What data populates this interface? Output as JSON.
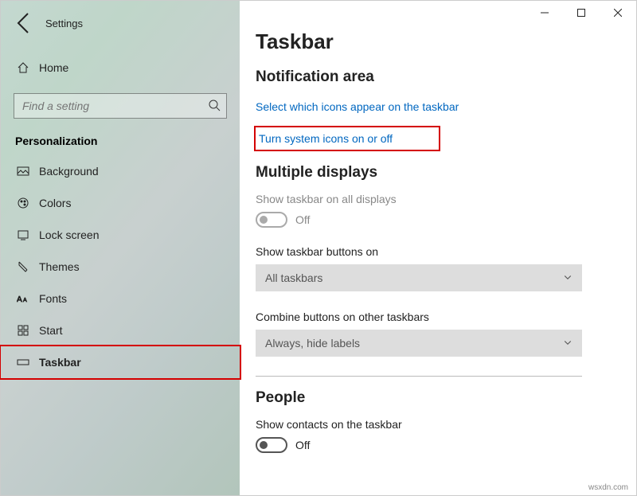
{
  "window": {
    "app_title": "Settings"
  },
  "sidebar": {
    "home_label": "Home",
    "search_placeholder": "Find a setting",
    "category_label": "Personalization",
    "items": [
      {
        "label": "Background"
      },
      {
        "label": "Colors"
      },
      {
        "label": "Lock screen"
      },
      {
        "label": "Themes"
      },
      {
        "label": "Fonts"
      },
      {
        "label": "Start"
      },
      {
        "label": "Taskbar"
      }
    ]
  },
  "main": {
    "page_title": "Taskbar",
    "notification_heading": "Notification area",
    "link_select_icons": "Select which icons appear on the taskbar",
    "link_system_icons": "Turn system icons on or off",
    "multiple_displays_heading": "Multiple displays",
    "show_all_displays_label": "Show taskbar on all displays",
    "show_all_displays_state": "Off",
    "show_buttons_label": "Show taskbar buttons on",
    "show_buttons_value": "All taskbars",
    "combine_label": "Combine buttons on other taskbars",
    "combine_value": "Always, hide labels",
    "people_heading": "People",
    "show_contacts_label": "Show contacts on the taskbar",
    "show_contacts_state": "Off"
  },
  "watermark": "wsxdn.com"
}
